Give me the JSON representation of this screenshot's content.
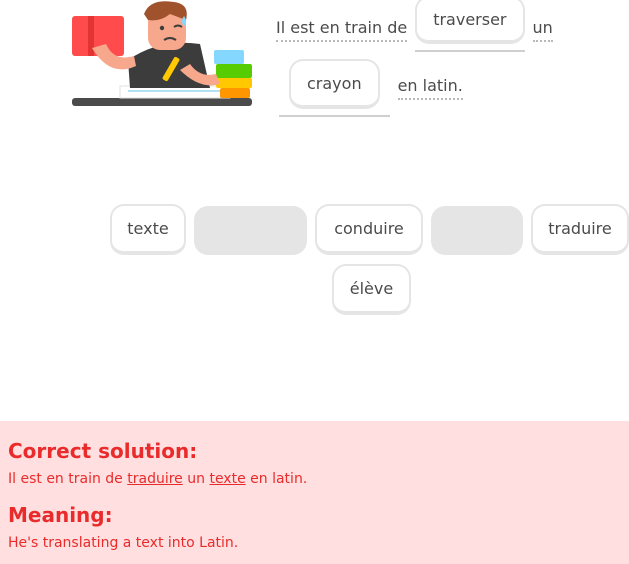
{
  "sentence": {
    "line1": {
      "prefix": "Il est en train de",
      "slot1": "traverser",
      "suffix": "un"
    },
    "line2": {
      "slot2": "crayon",
      "suffix": "en latin."
    }
  },
  "word_bank": {
    "chips": [
      "texte",
      "conduire",
      "traduire",
      "élève"
    ]
  },
  "feedback": {
    "correct_heading": "Correct solution:",
    "correct_parts": {
      "p1": "Il est en train de ",
      "u1": "traduire",
      "p2": " un ",
      "u2": "texte",
      "p3": " en latin."
    },
    "meaning_heading": "Meaning:",
    "meaning_text": "He's translating a text into Latin.",
    "color": "#ea2b2b",
    "background": "#ffdfe0"
  }
}
